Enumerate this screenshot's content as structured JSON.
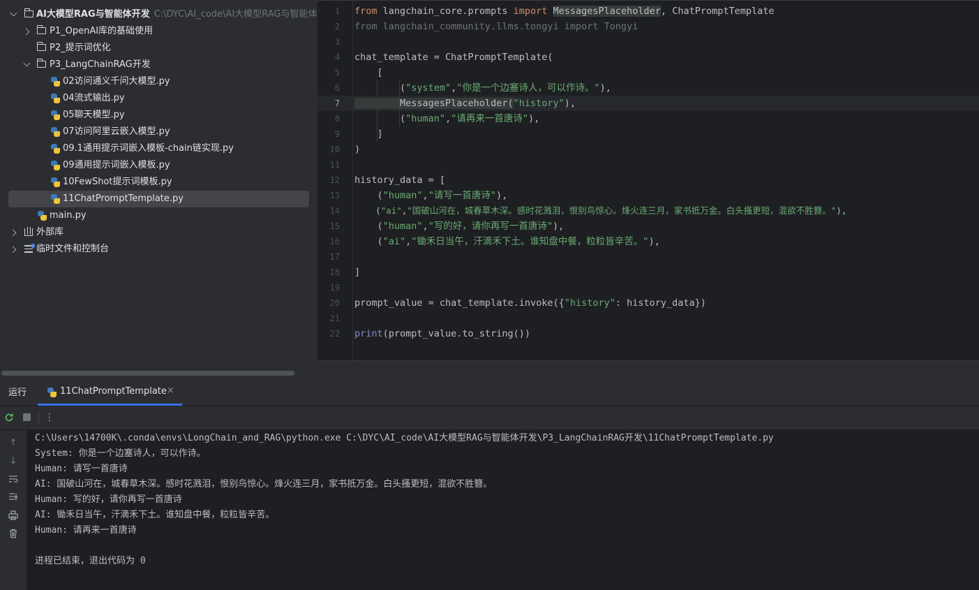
{
  "project_tree": {
    "root": {
      "name": "AI大模型RAG与智能体开发",
      "path": "C:\\DYC\\AI_code\\AI大模型RAG与智能体开"
    },
    "items": [
      {
        "label": "P1_OpenAI库的基础使用",
        "type": "folder",
        "expanded": false
      },
      {
        "label": "P2_提示词优化",
        "type": "folder"
      },
      {
        "label": "P3_LangChainRAG开发",
        "type": "folder",
        "expanded": true
      },
      {
        "label": "02访问通义千问大模型.py",
        "type": "python"
      },
      {
        "label": "04流式输出.py",
        "type": "python"
      },
      {
        "label": "05聊天模型.py",
        "type": "python"
      },
      {
        "label": "07访问阿里云嵌入模型.py",
        "type": "python"
      },
      {
        "label": "09.1通用提示词嵌入模板-chain链实现.py",
        "type": "python"
      },
      {
        "label": "09通用提示词嵌入模板.py",
        "type": "python"
      },
      {
        "label": "10FewShot提示词模板.py",
        "type": "python"
      },
      {
        "label": "11ChatPromptTemplate.py",
        "type": "python",
        "selected": true
      },
      {
        "label": "main.py",
        "type": "python"
      },
      {
        "label": "外部库",
        "type": "library"
      },
      {
        "label": "临时文件和控制台",
        "type": "scratches"
      }
    ]
  },
  "editor": {
    "current_line": 7,
    "line_numbers": [
      "1",
      "2",
      "3",
      "4",
      "5",
      "6",
      "7",
      "8",
      "9",
      "10",
      "11",
      "12",
      "13",
      "14",
      "15",
      "16",
      "17",
      "18",
      "19",
      "20",
      "21",
      "22"
    ],
    "code": {
      "l1_from": "from",
      "l1_mod": " langchain_core.prompts ",
      "l1_import": "import",
      "l1_name1": "MessagesPlaceholder",
      "l1_rest": ", ChatPromptTemplate",
      "l2": "from langchain_community.llms.tongyi import Tongyi",
      "l4": "chat_template = ChatPromptTemplate(",
      "l5": "    [",
      "l6_a": "        (",
      "l6_s1": "\"system\"",
      "l6_b": ",",
      "l6_s2": "\"你是一个边塞诗人，可以作诗。\"",
      "l6_c": "),",
      "l7_a": "        MessagesPlaceholder(",
      "l7_s": "\"history\"",
      "l7_b": "),",
      "l8_a": "        (",
      "l8_s1": "\"human\"",
      "l8_b": ",",
      "l8_s2": "\"请再来一首唐诗\"",
      "l8_c": "),",
      "l9": "    ]",
      "l10": ")",
      "l12": "history_data = [",
      "l13_a": "    (",
      "l13_s1": "\"human\"",
      "l13_b": ",",
      "l13_s2": "\"请写一首唐诗\"",
      "l13_c": "),",
      "l14_a": "    (",
      "l14_s1": "\"ai\"",
      "l14_b": ",",
      "l14_s2": "\"国破山河在，城春草木深。感时花溅泪，恨别鸟惊心。烽火连三月，家书抵万金。白头搔更短，混欲不胜簪。\"",
      "l14_c": "),",
      "l15_a": "    (",
      "l15_s1": "\"human\"",
      "l15_b": ",",
      "l15_s2": "\"写的好，请你再写一首唐诗\"",
      "l15_c": "),",
      "l16_a": "    (",
      "l16_s1": "\"ai\"",
      "l16_b": ",",
      "l16_s2": "\"锄禾日当午，汗滴禾下土。谁知盘中餐，粒粒皆辛苦。\"",
      "l16_c": "),",
      "l18": "]",
      "l20_a": "prompt_value = chat_template.invoke({",
      "l20_s": "\"history\"",
      "l20_b": ": history_data})",
      "l22_print": "print",
      "l22_rest": "(prompt_value.to_string())"
    }
  },
  "run_panel": {
    "title": "运行",
    "tab_label": "11ChatPromptTemplate",
    "close_glyph": "×",
    "toolbar_icons": [
      "rerun-icon",
      "stop-icon",
      "more-icon"
    ],
    "more_glyph": "⋮",
    "side_icons": [
      "scroll-up-icon",
      "scroll-down-icon",
      "soft-wrap-icon",
      "scroll-to-end-icon",
      "print-icon",
      "trash-icon"
    ],
    "console_lines": [
      "C:\\Users\\14700K\\.conda\\envs\\LongChain_and_RAG\\python.exe C:\\DYC\\AI_code\\AI大模型RAG与智能体开发\\P3_LangChainRAG开发\\11ChatPromptTemplate.py",
      "System: 你是一个边塞诗人，可以作诗。",
      "Human: 请写一首唐诗",
      "AI: 国破山河在，城春草木深。感时花溅泪，恨别鸟惊心。烽火连三月，家书抵万金。白头搔更短，混欲不胜簪。",
      "Human: 写的好，请你再写一首唐诗",
      "AI: 锄禾日当午，汗滴禾下土。谁知盘中餐，粒粒皆辛苦。",
      "Human: 请再来一首唐诗",
      "",
      "进程已结束，退出代码为 0"
    ]
  },
  "colors": {
    "keyword": "#cf8e6d",
    "string": "#6aab73",
    "accent": "#3574f0",
    "editor_bg": "#1e1f22",
    "panel_bg": "#2b2d30"
  }
}
